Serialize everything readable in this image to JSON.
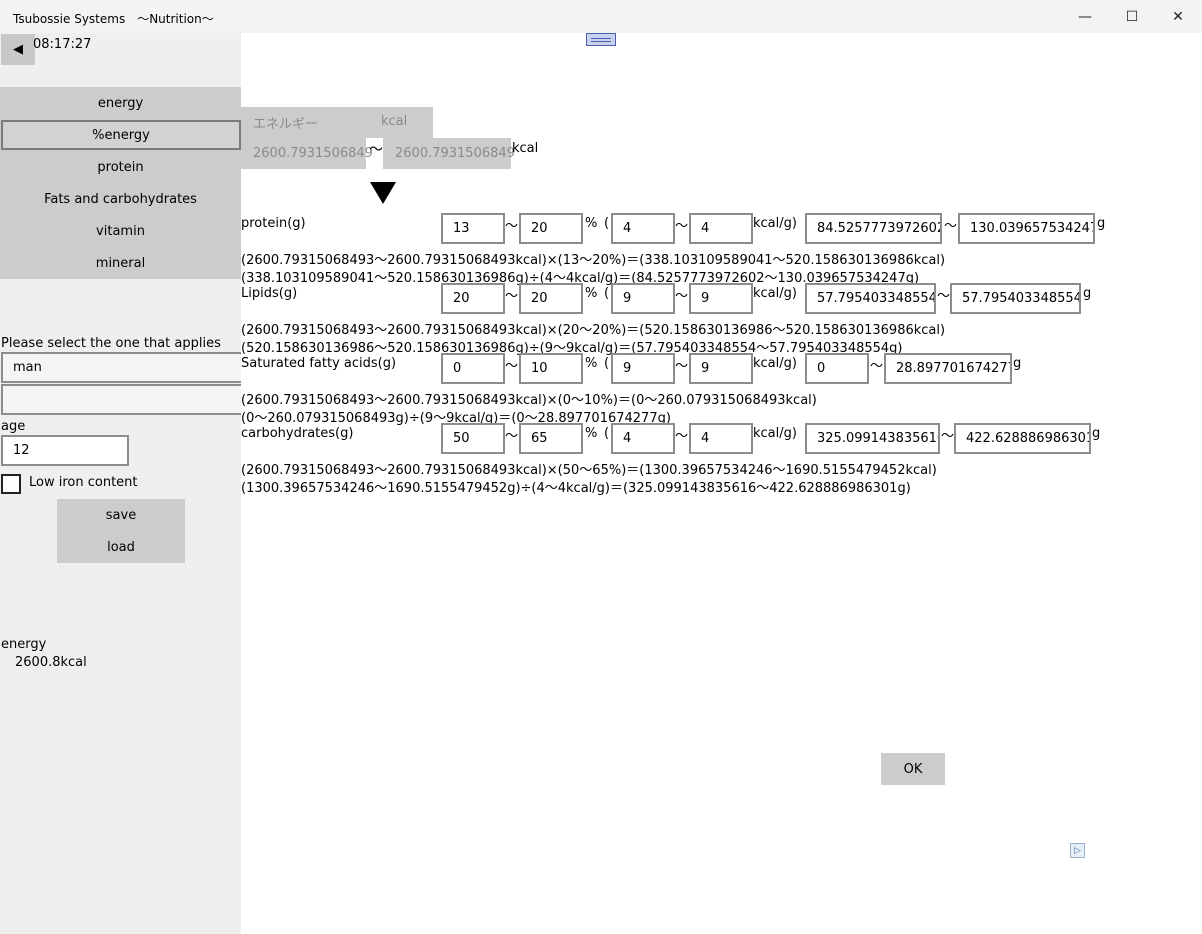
{
  "window": {
    "title": "Tsubossie Systems　〜Nutrition〜",
    "minimize_glyph": "—",
    "maximize_glyph": "☐",
    "close_glyph": "✕"
  },
  "sidebar": {
    "back_glyph": "◀",
    "clock": "08:17:27",
    "menu": [
      "energy",
      "%energy",
      "protein",
      "Fats and carbohydrates",
      "vitamin",
      "mineral"
    ],
    "selected_menu": "%energy",
    "select_label": "Please select the one that applies",
    "gender_value": "man",
    "age_label": "age",
    "age_value": "12",
    "iron_label": "Low iron content",
    "save_label": "save",
    "load_label": "load",
    "energy_label": "energy",
    "energy_value": "2600.8kcal"
  },
  "energy_panel": {
    "header_label": "エネルギー",
    "header_unit": "kcal",
    "min": "2600.7931506849",
    "tilde": "〜",
    "max": "2600.7931506849",
    "unit": "kcal"
  },
  "symbols": {
    "tilde": "〜",
    "percent": "%",
    "paren": "(",
    "kcal_per_g": "kcal/g)",
    "gram": "g"
  },
  "rows": [
    {
      "label": "protein(g)",
      "pct_min": "13",
      "pct_max": "20",
      "kcal_min": "4",
      "kcal_max": "4",
      "g_min": "84.5257773972602",
      "g_max": "130.039657534247",
      "calc1": "(2600.79315068493〜2600.79315068493kcal)×(13〜20%)＝(338.103109589041〜520.158630136986kcal)",
      "calc2": "(338.103109589041〜520.158630136986g)÷(4〜4kcal/g)＝(84.5257773972602〜130.039657534247g)"
    },
    {
      "label": "Lipids(g)",
      "pct_min": "20",
      "pct_max": "20",
      "kcal_min": "9",
      "kcal_max": "9",
      "g_min": "57.795403348554",
      "g_max": "57.795403348554",
      "calc1": "(2600.79315068493〜2600.79315068493kcal)×(20〜20%)＝(520.158630136986〜520.158630136986kcal)",
      "calc2": "(520.158630136986〜520.158630136986g)÷(9〜9kcal/g)＝(57.795403348554〜57.795403348554g)"
    },
    {
      "label": "Saturated fatty acids(g)",
      "pct_min": "0",
      "pct_max": "10",
      "kcal_min": "9",
      "kcal_max": "9",
      "g_min": "0",
      "g_max": "28.897701674277",
      "calc1": "(2600.79315068493〜2600.79315068493kcal)×(0〜10%)＝(0〜260.079315068493kcal)",
      "calc2": "(0〜260.079315068493g)÷(9〜9kcal/g)＝(0〜28.897701674277g)"
    },
    {
      "label": "carbohydrates(g)",
      "pct_min": "50",
      "pct_max": "65",
      "kcal_min": "4",
      "kcal_max": "4",
      "g_min": "325.099143835616",
      "g_max": "422.628886986301",
      "calc1": "(2600.79315068493〜2600.79315068493kcal)×(50〜65%)＝(1300.39657534246〜1690.5155479452kcal)",
      "calc2": "(1300.39657534246〜1690.5155479452g)÷(4〜4kcal/g)＝(325.099143835616〜422.628886986301g)"
    }
  ],
  "ok_label": "OK",
  "ad_glyph": "▷"
}
